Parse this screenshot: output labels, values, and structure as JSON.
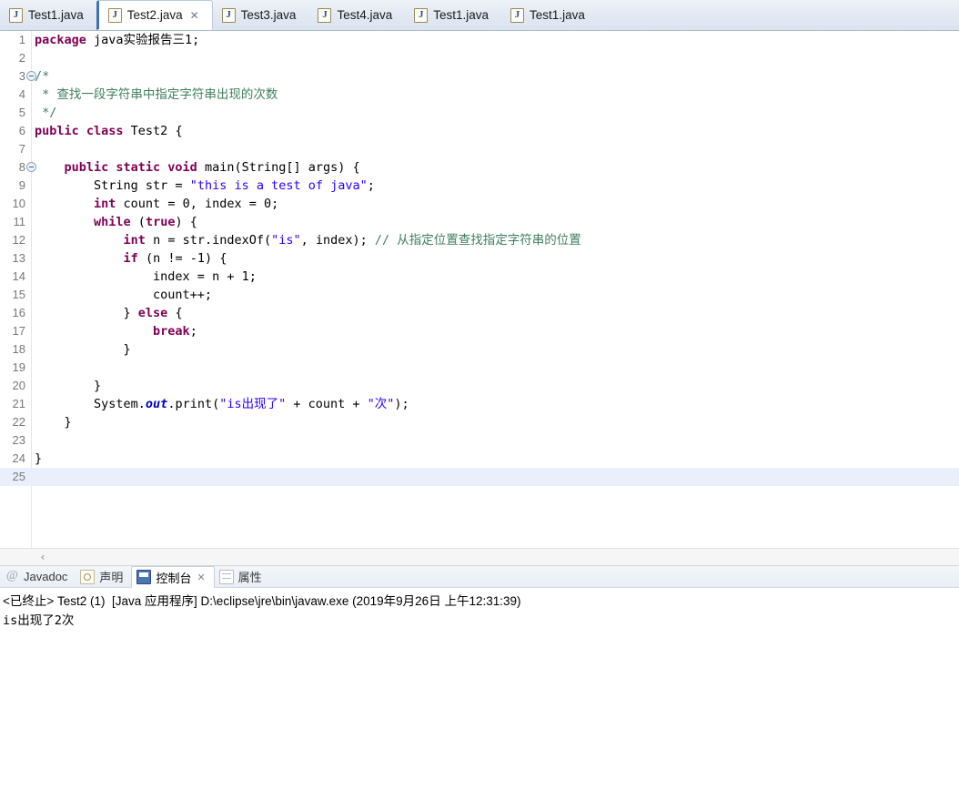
{
  "editor_tabs": [
    {
      "label": "Test1.java",
      "icon": "java-file-icon",
      "active": false,
      "closable": false
    },
    {
      "label": "Test2.java",
      "icon": "java-file-icon",
      "active": true,
      "closable": true,
      "close_glyph": "✕"
    },
    {
      "label": "Test3.java",
      "icon": "java-file-icon",
      "active": false,
      "closable": false
    },
    {
      "label": "Test4.java",
      "icon": "java-file-icon",
      "active": false,
      "closable": false
    },
    {
      "label": "Test1.java",
      "icon": "java-file-icon",
      "active": false,
      "closable": false
    },
    {
      "label": "Test1.java",
      "icon": "java-file-icon",
      "active": false,
      "closable": false
    }
  ],
  "code": {
    "lines": [
      {
        "n": "1",
        "fold": false,
        "current": false,
        "tokens": [
          {
            "t": "package",
            "c": "k"
          },
          {
            "t": " java实验报告三1;",
            "c": "p"
          }
        ]
      },
      {
        "n": "2",
        "fold": false,
        "current": false,
        "tokens": []
      },
      {
        "n": "3",
        "fold": true,
        "current": false,
        "tokens": [
          {
            "t": "/*",
            "c": "c"
          }
        ]
      },
      {
        "n": "4",
        "fold": false,
        "current": false,
        "tokens": [
          {
            "t": " * 查找一段字符串中指定字符串出现的次数",
            "c": "c"
          }
        ]
      },
      {
        "n": "5",
        "fold": false,
        "current": false,
        "tokens": [
          {
            "t": " */",
            "c": "c"
          }
        ]
      },
      {
        "n": "6",
        "fold": false,
        "current": false,
        "tokens": [
          {
            "t": "public class",
            "c": "k"
          },
          {
            "t": " Test2 {",
            "c": "p"
          }
        ]
      },
      {
        "n": "7",
        "fold": false,
        "current": false,
        "tokens": []
      },
      {
        "n": "8",
        "fold": true,
        "current": false,
        "tokens": [
          {
            "t": "    ",
            "c": "p"
          },
          {
            "t": "public static void",
            "c": "k"
          },
          {
            "t": " main(String[] args) {",
            "c": "p"
          }
        ]
      },
      {
        "n": "9",
        "fold": false,
        "current": false,
        "tokens": [
          {
            "t": "        String str = ",
            "c": "p"
          },
          {
            "t": "\"this is a test of java\"",
            "c": "s"
          },
          {
            "t": ";",
            "c": "p"
          }
        ]
      },
      {
        "n": "10",
        "fold": false,
        "current": false,
        "tokens": [
          {
            "t": "        ",
            "c": "p"
          },
          {
            "t": "int",
            "c": "k"
          },
          {
            "t": " count = 0, index = 0;",
            "c": "p"
          }
        ]
      },
      {
        "n": "11",
        "fold": false,
        "current": false,
        "tokens": [
          {
            "t": "        ",
            "c": "p"
          },
          {
            "t": "while",
            "c": "k"
          },
          {
            "t": " (",
            "c": "p"
          },
          {
            "t": "true",
            "c": "k"
          },
          {
            "t": ") {",
            "c": "p"
          }
        ]
      },
      {
        "n": "12",
        "fold": false,
        "current": false,
        "tokens": [
          {
            "t": "            ",
            "c": "p"
          },
          {
            "t": "int",
            "c": "k"
          },
          {
            "t": " n = str.indexOf(",
            "c": "p"
          },
          {
            "t": "\"is\"",
            "c": "s"
          },
          {
            "t": ", index); ",
            "c": "p"
          },
          {
            "t": "// 从指定位置查找指定字符串的位置",
            "c": "c"
          }
        ]
      },
      {
        "n": "13",
        "fold": false,
        "current": false,
        "tokens": [
          {
            "t": "            ",
            "c": "p"
          },
          {
            "t": "if",
            "c": "k"
          },
          {
            "t": " (n != -1) {",
            "c": "p"
          }
        ]
      },
      {
        "n": "14",
        "fold": false,
        "current": false,
        "tokens": [
          {
            "t": "                index = n + 1;",
            "c": "p"
          }
        ]
      },
      {
        "n": "15",
        "fold": false,
        "current": false,
        "tokens": [
          {
            "t": "                count++;",
            "c": "p"
          }
        ]
      },
      {
        "n": "16",
        "fold": false,
        "current": false,
        "tokens": [
          {
            "t": "            } ",
            "c": "p"
          },
          {
            "t": "else",
            "c": "k"
          },
          {
            "t": " {",
            "c": "p"
          }
        ]
      },
      {
        "n": "17",
        "fold": false,
        "current": false,
        "tokens": [
          {
            "t": "                ",
            "c": "p"
          },
          {
            "t": "break",
            "c": "k"
          },
          {
            "t": ";",
            "c": "p"
          }
        ]
      },
      {
        "n": "18",
        "fold": false,
        "current": false,
        "tokens": [
          {
            "t": "            }",
            "c": "p"
          }
        ]
      },
      {
        "n": "19",
        "fold": false,
        "current": false,
        "tokens": []
      },
      {
        "n": "20",
        "fold": false,
        "current": false,
        "tokens": [
          {
            "t": "        }",
            "c": "p"
          }
        ]
      },
      {
        "n": "21",
        "fold": false,
        "current": false,
        "tokens": [
          {
            "t": "        System.",
            "c": "p"
          },
          {
            "t": "out",
            "c": "f"
          },
          {
            "t": ".print(",
            "c": "p"
          },
          {
            "t": "\"is出现了\"",
            "c": "s"
          },
          {
            "t": " + count + ",
            "c": "p"
          },
          {
            "t": "\"次\"",
            "c": "s"
          },
          {
            "t": ");",
            "c": "p"
          }
        ]
      },
      {
        "n": "22",
        "fold": false,
        "current": false,
        "tokens": [
          {
            "t": "    }",
            "c": "p"
          }
        ]
      },
      {
        "n": "23",
        "fold": false,
        "current": false,
        "tokens": []
      },
      {
        "n": "24",
        "fold": false,
        "current": false,
        "tokens": [
          {
            "t": "}",
            "c": "p"
          }
        ]
      },
      {
        "n": "25",
        "fold": false,
        "current": true,
        "tokens": []
      }
    ]
  },
  "editor_scrollbar": {
    "left_arrow_glyph": "‹"
  },
  "bottom_tabs": [
    {
      "label": "Javadoc",
      "icon": "at-icon",
      "active": false,
      "closable": false
    },
    {
      "label": "声明",
      "icon": "declaration-icon",
      "active": false,
      "closable": false
    },
    {
      "label": "控制台",
      "icon": "console-icon",
      "active": true,
      "closable": true,
      "close_glyph": "✕"
    },
    {
      "label": "属性",
      "icon": "properties-icon",
      "active": false,
      "closable": false
    }
  ],
  "console": {
    "header": "<已终止> Test2 (1)  [Java 应用程序] D:\\eclipse\\jre\\bin\\javaw.exe (2019年9月26日 上午12:31:39)",
    "output": "is出现了2次"
  },
  "colors": {
    "keyword": "#7f0055",
    "string": "#2a00ff",
    "comment": "#3f7f5f",
    "static_field": "#0000c0",
    "current_line": "#eaf0fb",
    "tab_accent": "#3f72b0"
  }
}
